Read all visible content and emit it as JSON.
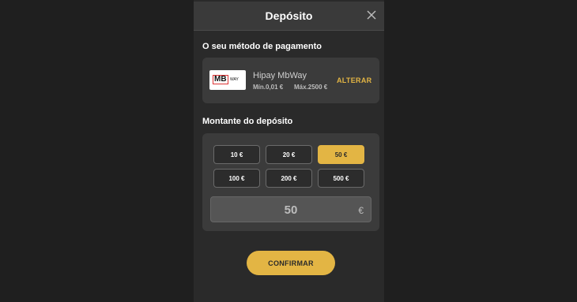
{
  "modal": {
    "title": "Depósito"
  },
  "payment_method": {
    "section_label": "O seu método de pagamento",
    "logo_text": "MB",
    "logo_subtext": "WAY",
    "name": "Hipay MbWay",
    "min_label": "Mín.0,01 €",
    "max_label": "Máx.2500 €",
    "change_label": "ALTERAR"
  },
  "deposit": {
    "section_label": "Montante do depósito",
    "options": [
      "10 €",
      "20 €",
      "50 €",
      "100 €",
      "200 €",
      "500 €"
    ],
    "selected_option": "50 €",
    "input_value": "50",
    "currency_symbol": "€"
  },
  "actions": {
    "confirm_label": "CONFIRMAR"
  },
  "colors": {
    "accent": "#e3b544",
    "background": "#1f1f1f",
    "panel": "#2a2a2a",
    "card": "#3b3b3b"
  },
  "icons": {
    "close": "close-icon"
  }
}
